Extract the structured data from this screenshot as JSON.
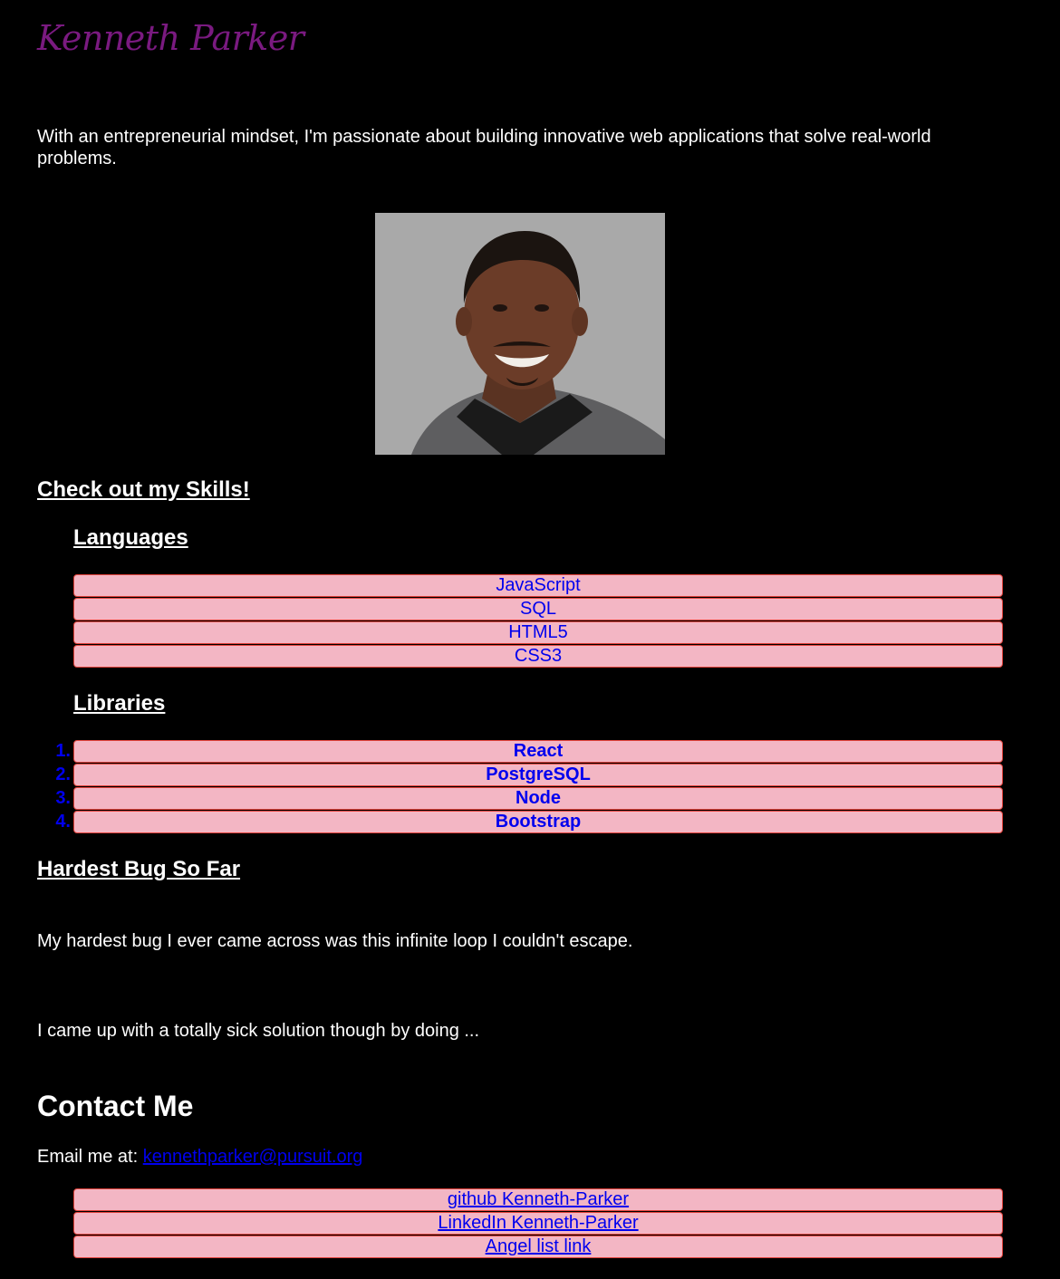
{
  "header": {
    "name": "Kenneth Parker"
  },
  "intro": "With an entrepreneurial mindset, I'm passionate about building innovative web applications that solve real-world problems.",
  "photo": {
    "icon": "profile-photo"
  },
  "skills": {
    "title": "Check out my Skills!",
    "languages_title": "Languages",
    "languages": [
      "JavaScript",
      "SQL",
      "HTML5",
      "CSS3"
    ],
    "libraries_title": "Libraries",
    "libraries": [
      {
        "num": "1.",
        "label": "React"
      },
      {
        "num": "2.",
        "label": "PostgreSQL"
      },
      {
        "num": "3.",
        "label": "Node"
      },
      {
        "num": "4.",
        "label": "Bootstrap"
      }
    ]
  },
  "bug": {
    "title": "Hardest Bug So Far",
    "p1": "My hardest bug I ever came across was this infinite loop I couldn't escape.",
    "p2": "I came up with a totally sick solution though by doing ..."
  },
  "contact": {
    "title": "Contact Me",
    "email_prefix": "Email me at:",
    "email": "kennethparker@pursuit.org",
    "links": [
      "github Kenneth-Parker",
      "LinkedIn Kenneth-Parker",
      "Angel list link"
    ]
  },
  "colors": {
    "background": "#000000",
    "name": "#7a1a80",
    "pill_bg": "#f3b6c4",
    "pill_border": "#e0413a",
    "link": "#0000ee"
  }
}
